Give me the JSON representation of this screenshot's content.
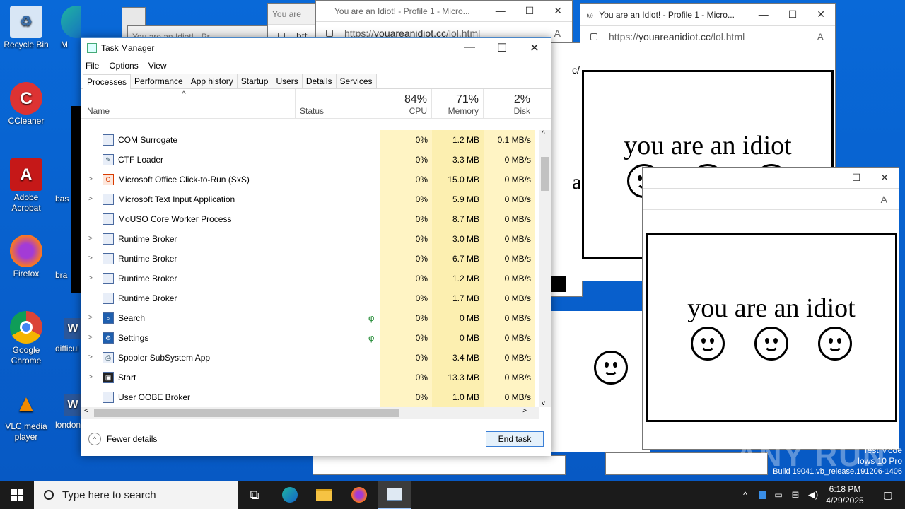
{
  "desktop": {
    "icons": [
      {
        "label": "Recycle Bin"
      },
      {
        "label": "CCleaner"
      },
      {
        "label": "Adobe Acrobat"
      },
      {
        "label": "Firefox"
      },
      {
        "label": "Google Chrome"
      },
      {
        "label": "VLC media player"
      }
    ],
    "partial_icons": [
      "M",
      "bas",
      "bra",
      "difficul",
      "london"
    ],
    "test_mode": [
      "Test Mode",
      "lows 10 Pro",
      "Build 19041.vb_release.191206-1406"
    ],
    "watermark": "ANY RUN"
  },
  "popups": {
    "title": "You are an Idiot! - Profile 1 - Micro...",
    "title_short": "You are",
    "title_back": "You are an Idiot! - Pr",
    "url_prefix": "https://",
    "url_domain": "youareanidiot.cc",
    "url_path": "/lol.html",
    "url_partial": "htt",
    "url_tail": "c/",
    "page_text": "you are an idiot"
  },
  "task_manager": {
    "title": "Task Manager",
    "menu": [
      "File",
      "Options",
      "View"
    ],
    "tabs": [
      "Processes",
      "Performance",
      "App history",
      "Startup",
      "Users",
      "Details",
      "Services"
    ],
    "columns": {
      "name": "Name",
      "status": "Status",
      "cpu": {
        "label": "CPU",
        "pct": "84%"
      },
      "memory": {
        "label": "Memory",
        "pct": "71%"
      },
      "disk": {
        "label": "Disk",
        "pct": "2%"
      }
    },
    "rows": [
      {
        "name": "COM Surrogate",
        "cpu": "0%",
        "mem": "1.2 MB",
        "disk": "0.1 MB/s"
      },
      {
        "name": "CTF Loader",
        "cpu": "0%",
        "mem": "3.3 MB",
        "disk": "0 MB/s"
      },
      {
        "name": "Microsoft Office Click-to-Run (SxS)",
        "cpu": "0%",
        "mem": "15.0 MB",
        "disk": "0 MB/s"
      },
      {
        "name": "Microsoft Text Input Application",
        "cpu": "0%",
        "mem": "5.9 MB",
        "disk": "0 MB/s"
      },
      {
        "name": "MoUSO Core Worker Process",
        "cpu": "0%",
        "mem": "8.7 MB",
        "disk": "0 MB/s"
      },
      {
        "name": "Runtime Broker",
        "cpu": "0%",
        "mem": "3.0 MB",
        "disk": "0 MB/s"
      },
      {
        "name": "Runtime Broker",
        "cpu": "0%",
        "mem": "6.7 MB",
        "disk": "0 MB/s"
      },
      {
        "name": "Runtime Broker",
        "cpu": "0%",
        "mem": "1.2 MB",
        "disk": "0 MB/s"
      },
      {
        "name": "Runtime Broker",
        "cpu": "0%",
        "mem": "1.7 MB",
        "disk": "0 MB/s"
      },
      {
        "name": "Search",
        "cpu": "0%",
        "mem": "0 MB",
        "disk": "0 MB/s"
      },
      {
        "name": "Settings",
        "cpu": "0%",
        "mem": "0 MB",
        "disk": "0 MB/s"
      },
      {
        "name": "Spooler SubSystem App",
        "cpu": "0%",
        "mem": "3.4 MB",
        "disk": "0 MB/s"
      },
      {
        "name": "Start",
        "cpu": "0%",
        "mem": "13.3 MB",
        "disk": "0 MB/s"
      },
      {
        "name": "User OOBE Broker",
        "cpu": "0%",
        "mem": "1.0 MB",
        "disk": "0 MB/s"
      }
    ],
    "footer": {
      "fewer_details": "Fewer details",
      "end_task": "End task"
    }
  },
  "taskbar": {
    "search_placeholder": "Type here to search",
    "time": "6:18 PM",
    "date": "4/29/2025"
  }
}
